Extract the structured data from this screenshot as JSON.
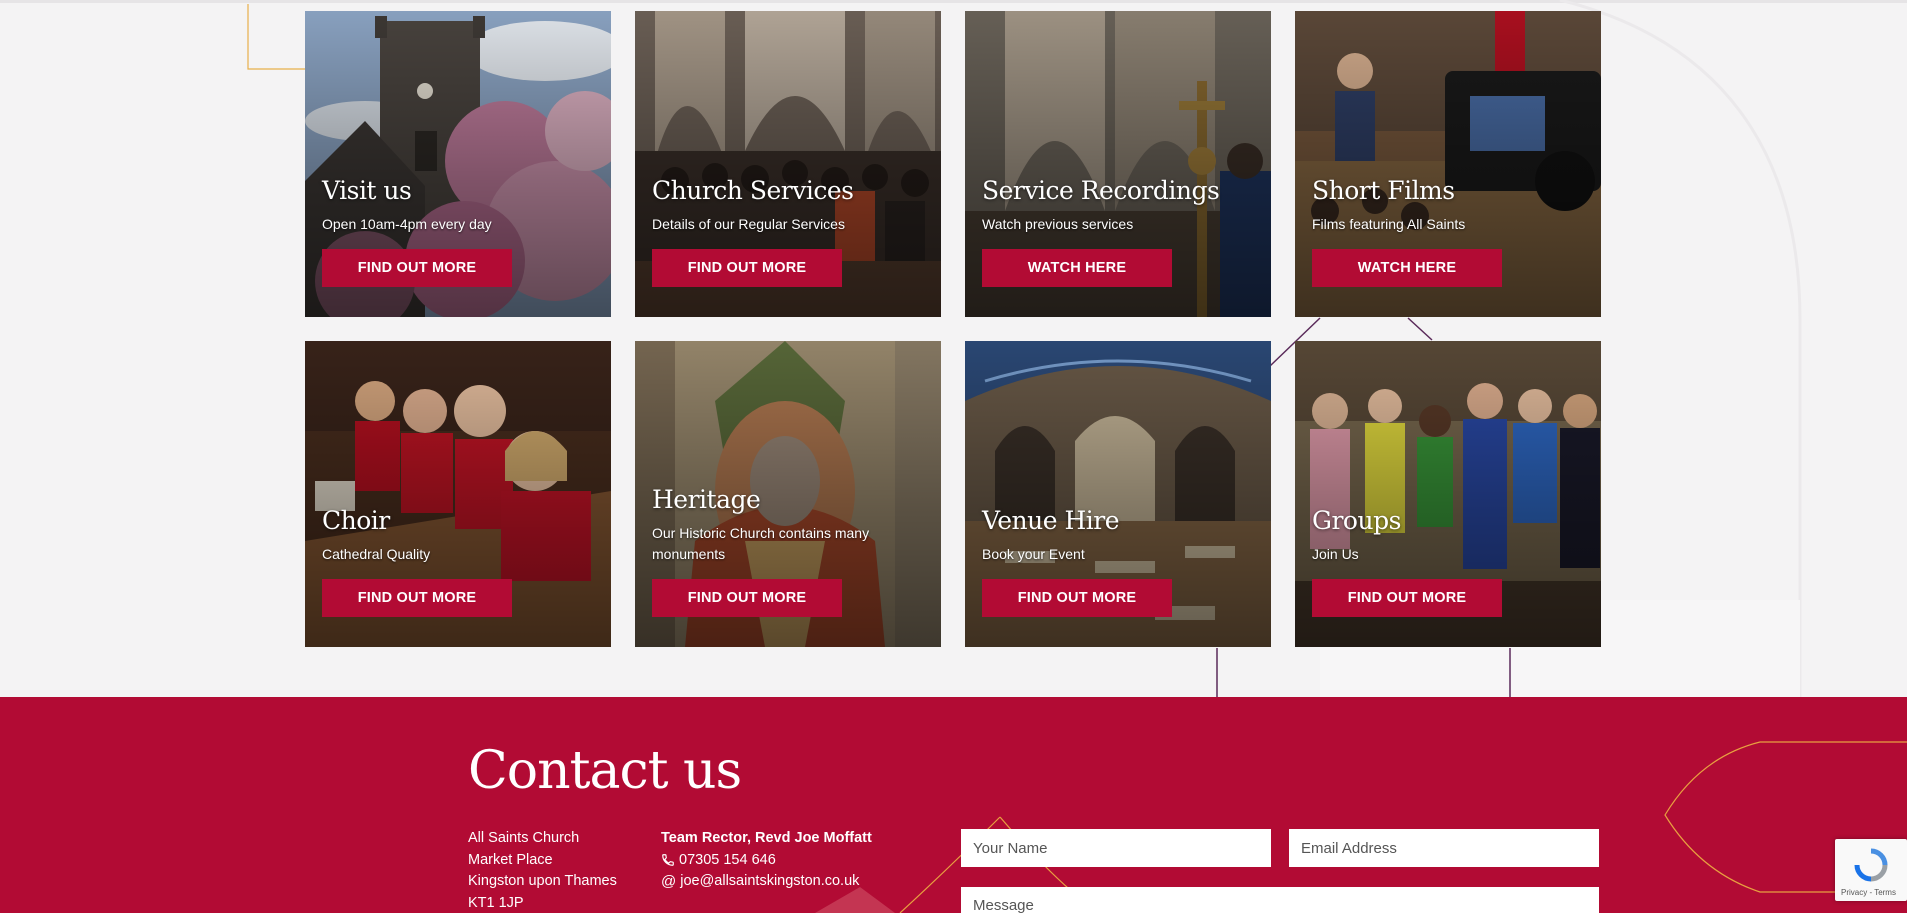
{
  "cards": [
    {
      "title": "Visit us",
      "subtitle": "Open 10am-4pm every day",
      "button": "FIND OUT MORE",
      "photo": "church-tower-magnolia"
    },
    {
      "title": "Church Services",
      "subtitle": "Details of our Regular Services",
      "button": "FIND OUT MORE",
      "photo": "congregation-nave"
    },
    {
      "title": "Service Recordings",
      "subtitle": "Watch previous services",
      "button": "WATCH HERE",
      "photo": "processional-cross"
    },
    {
      "title": "Short Films",
      "subtitle": "Films featuring All Saints",
      "button": "WATCH HERE",
      "photo": "film-camera"
    },
    {
      "title": "Choir",
      "subtitle": "Cathedral Quality",
      "button": "FIND OUT MORE",
      "photo": "choir-children"
    },
    {
      "title": "Heritage",
      "subtitle": "Our Historic Church contains many monuments",
      "button": "FIND OUT MORE",
      "photo": "wall-painting"
    },
    {
      "title": "Venue Hire",
      "subtitle": "Book your Event",
      "button": "FIND OUT MORE",
      "photo": "church-interior-tables"
    },
    {
      "title": "Groups",
      "subtitle": "Join Us",
      "button": "FIND OUT MORE",
      "photo": "bell-ringers"
    }
  ],
  "contact": {
    "heading": "Contact us",
    "address": [
      "All Saints Church",
      "Market Place",
      "Kingston upon Thames",
      "KT1 1JP"
    ],
    "rector_name": "Team Rector, Revd Joe Moffatt",
    "phone": "07305 154 646",
    "email": "joe@allsaintskingston.co.uk"
  },
  "form": {
    "name_placeholder": "Your Name",
    "email_placeholder": "Email Address",
    "message_placeholder": "Message"
  },
  "recaptcha": {
    "terms": "Privacy - Terms"
  },
  "colors": {
    "accent": "#b20b34",
    "background": "#f4f3f4",
    "deco_line": "#5a2a5a",
    "deco_gold": "#e8b04a"
  }
}
